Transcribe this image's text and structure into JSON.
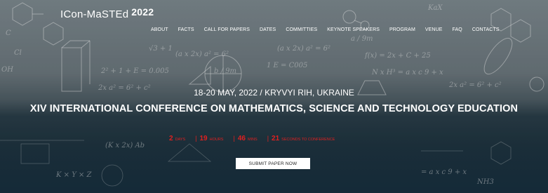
{
  "logo": {
    "name": "ICon-MaSTEd",
    "year": "2022"
  },
  "nav": [
    {
      "label": "ABOUT"
    },
    {
      "label": "FACTS"
    },
    {
      "label": "CALL FOR PAPERS"
    },
    {
      "label": "DATES"
    },
    {
      "label": "COMMITTIES"
    },
    {
      "label": "KEYNOTE SPEAKERS"
    },
    {
      "label": "PROGRAM"
    },
    {
      "label": "VENUE"
    },
    {
      "label": "FAQ"
    },
    {
      "label": "CONTACTS"
    }
  ],
  "event": {
    "date_location": "18-20 MAY, 2022 / KRYVYI RIH, UKRAINE",
    "title": "XIV INTERNATIONAL CONFERENCE ON MATHEMATICS, SCIENCE AND TECHNOLOGY EDUCATION"
  },
  "countdown": [
    {
      "value": "2",
      "label": "DAYS"
    },
    {
      "value": "19",
      "label": "HOURS"
    },
    {
      "value": "46",
      "label": "MINS"
    },
    {
      "value": "21",
      "label": "SECONDS TO CONFERENCE"
    }
  ],
  "cta": {
    "label": "SUBMIT PAPER NOW"
  },
  "colors": {
    "countdown": "#e02020",
    "button_bg": "#ffffff"
  }
}
